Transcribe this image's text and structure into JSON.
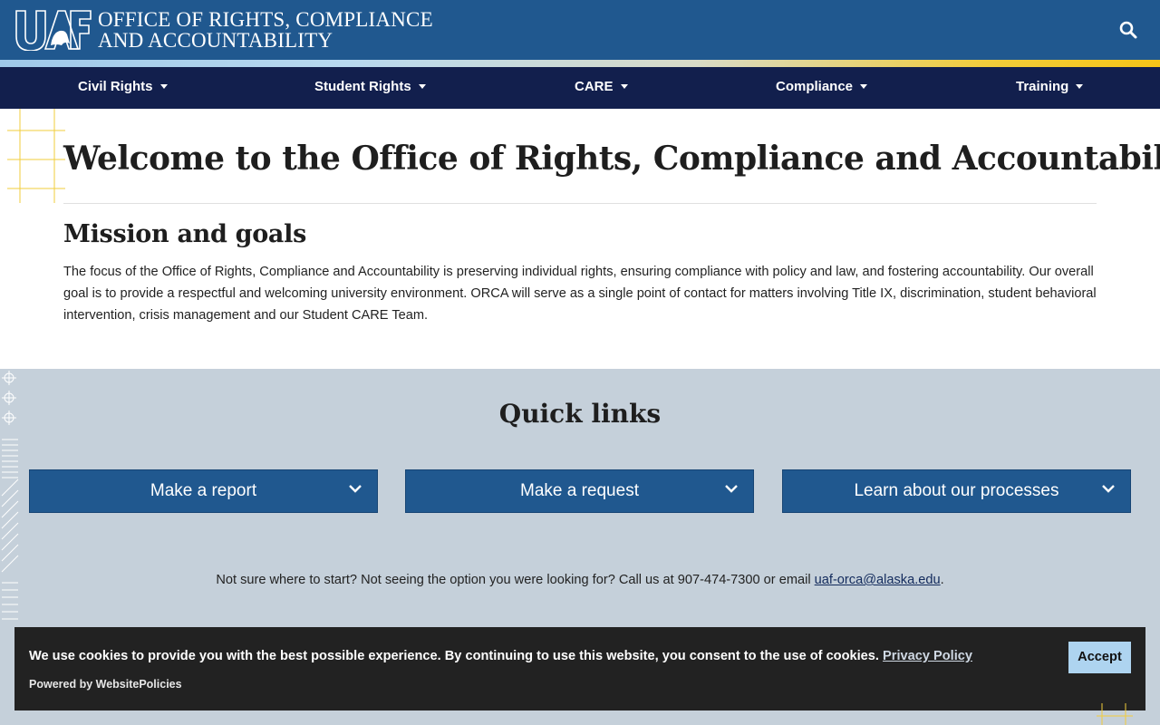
{
  "header": {
    "logo_text": "UAF",
    "title_line1": "OFFICE OF RIGHTS, COMPLIANCE",
    "title_line2": "AND ACCOUNTABILITY",
    "search_icon": "search-icon"
  },
  "nav": {
    "items": [
      {
        "label": "Civil Rights"
      },
      {
        "label": "Student Rights"
      },
      {
        "label": "CARE"
      },
      {
        "label": "Compliance"
      },
      {
        "label": "Training"
      }
    ]
  },
  "main": {
    "title": "Welcome to the Office of Rights, Compliance and Accountability",
    "mission_heading": "Mission and goals",
    "mission_text": "The focus of the Office of Rights, Compliance and Accountability is preserving individual rights, ensuring compliance with policy and law, and fostering accountability. Our overall goal is to provide a respectful and welcoming university environment. ORCA will serve as a single point of contact for matters involving Title IX, discrimination, student behavioral intervention, crisis management and our Student CARE Team."
  },
  "quick_links": {
    "heading": "Quick links",
    "buttons": [
      {
        "label": "Make a report"
      },
      {
        "label": "Make a request"
      },
      {
        "label": "Learn about our processes"
      }
    ],
    "help_text": "Not sure where to start? Not seeing the option you were looking for? Call us at 907-474-7300 or email ",
    "help_email": "uaf-orca@alaska.edu",
    "help_end": "."
  },
  "cookie": {
    "text": "We use cookies to provide you with the best possible experience. By continuing to use this website, you consent to the use of cookies. ",
    "policy_link": "Privacy Policy",
    "powered_by": "Powered by WebsitePolicies",
    "accept_label": "Accept"
  },
  "colors": {
    "header_blue": "#20588f",
    "nav_navy": "#121f4d",
    "quick_bg": "#c5d0da",
    "accent_gold": "#f5c518"
  }
}
